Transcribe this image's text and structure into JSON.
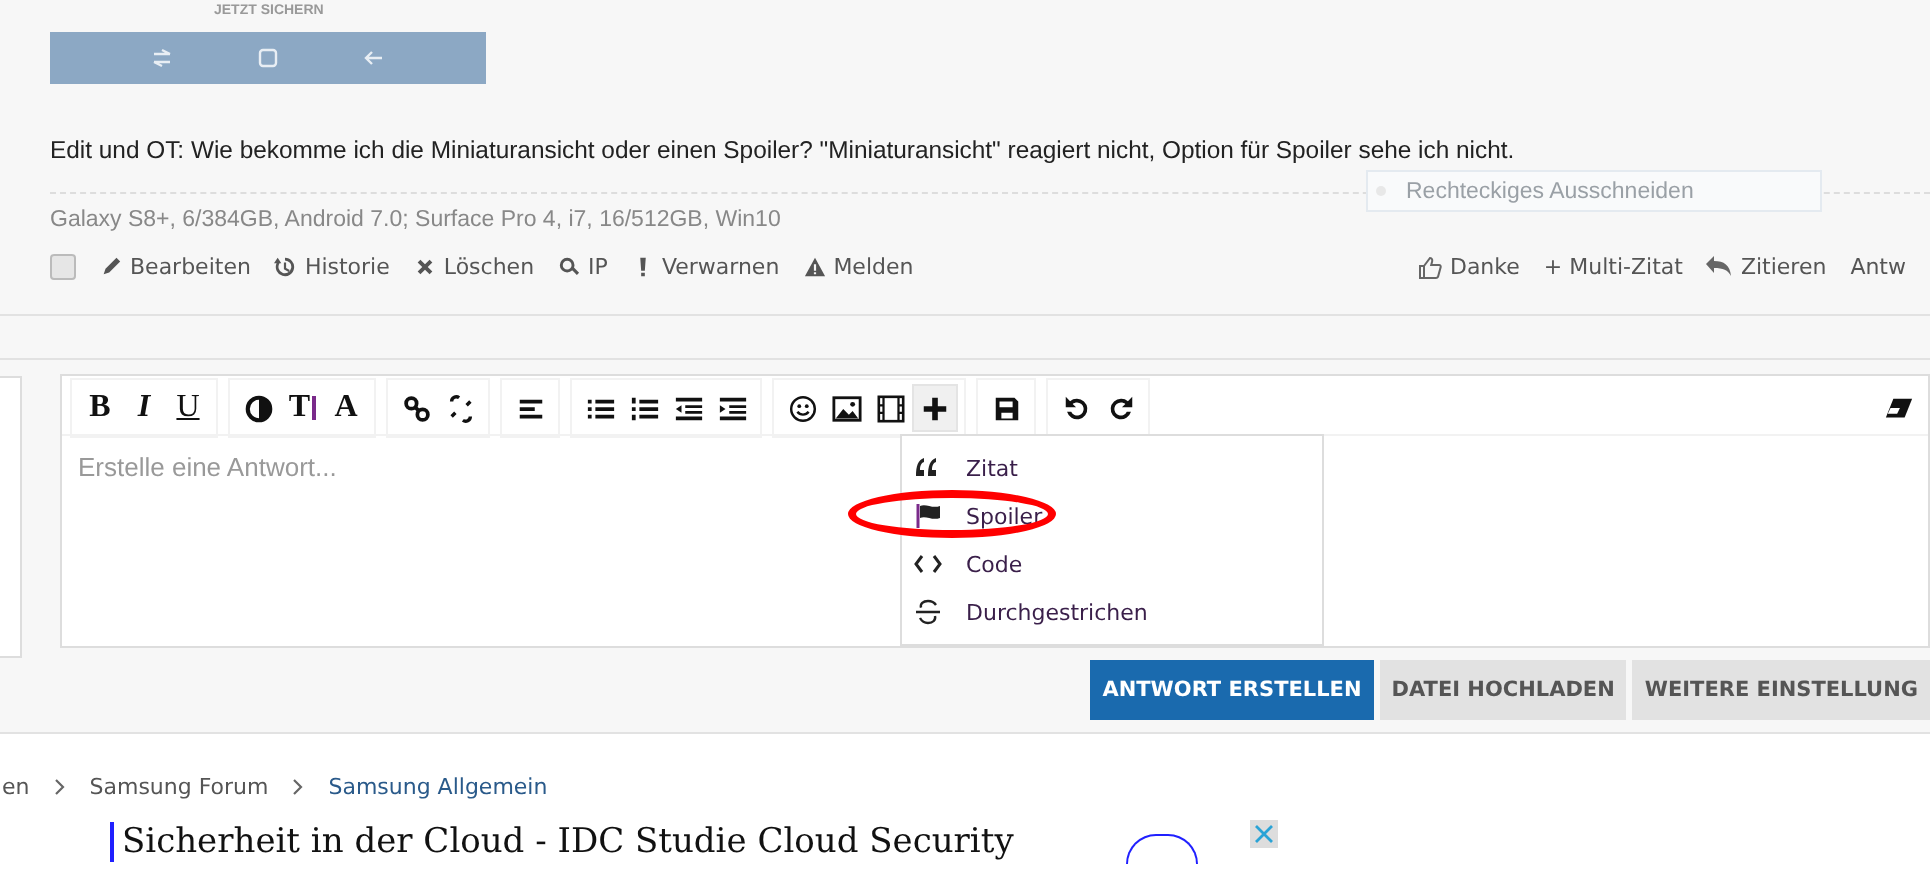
{
  "banner": {
    "label": "JETZT SICHERN"
  },
  "post": {
    "text": "Edit und OT: Wie bekomme ich die Miniaturansicht oder einen Spoiler? \"Miniaturansicht\" reagiert nicht, Option für Spoiler sehe ich nicht.",
    "overlay_tooltip": "Rechteckiges Ausschneiden",
    "signature": "Galaxy S8+, 6/384GB, Android 7.0; Surface Pro 4, i7, 16/512GB, Win10",
    "select_checked": false,
    "actions": [
      {
        "kind": "edit",
        "label": "Bearbeiten"
      },
      {
        "kind": "history",
        "label": "Historie"
      },
      {
        "kind": "delete",
        "label": "Löschen"
      },
      {
        "kind": "ip",
        "label": "IP"
      },
      {
        "kind": "warn",
        "label": "Verwarnen"
      },
      {
        "kind": "report",
        "label": "Melden"
      }
    ],
    "right_actions": [
      {
        "kind": "like",
        "label": "Danke"
      },
      {
        "kind": "plain",
        "label": "+ Multi-Zitat"
      },
      {
        "kind": "quote",
        "label": "Zitieren"
      },
      {
        "kind": "plain",
        "label": "Antw"
      }
    ]
  },
  "editor": {
    "toolbar": [
      [
        {
          "kind": "bold",
          "glyph": "B"
        },
        {
          "kind": "italic",
          "glyph": "I"
        },
        {
          "kind": "underline",
          "glyph": "U"
        }
      ],
      [
        {
          "kind": "contrast"
        },
        {
          "kind": "size",
          "glyph": "T"
        },
        {
          "kind": "font",
          "glyph": "A"
        }
      ],
      [
        {
          "kind": "link"
        },
        {
          "kind": "unlink"
        }
      ],
      [
        {
          "kind": "align"
        }
      ],
      [
        {
          "kind": "bullets"
        },
        {
          "kind": "numbers"
        },
        {
          "kind": "outdent"
        },
        {
          "kind": "indent"
        }
      ],
      [
        {
          "kind": "smiley"
        },
        {
          "kind": "image"
        },
        {
          "kind": "media"
        },
        {
          "kind": "plus",
          "open": true
        }
      ],
      [
        {
          "kind": "save"
        }
      ],
      [
        {
          "kind": "undo"
        },
        {
          "kind": "redo"
        }
      ]
    ],
    "eraser": true,
    "placeholder": "Erstelle eine Antwort...",
    "menu": [
      {
        "kind": "quote",
        "label": "Zitat"
      },
      {
        "kind": "spoiler",
        "label": "Spoiler",
        "circled": true
      },
      {
        "kind": "code",
        "label": "Code"
      },
      {
        "kind": "strike",
        "label": "Durchgestrichen"
      }
    ],
    "buttons": [
      {
        "label": "ANTWORT ERSTELLEN",
        "primary": true
      },
      {
        "label": "DATEI HOCHLADEN",
        "primary": false
      },
      {
        "label": "WEITERE EINSTELLUNG",
        "primary": false
      }
    ]
  },
  "breadcrumb": [
    "en",
    "Samsung Forum",
    "Samsung Allgemein"
  ],
  "ad": {
    "title": "Sicherheit in der Cloud - IDC Studie Cloud Security"
  }
}
